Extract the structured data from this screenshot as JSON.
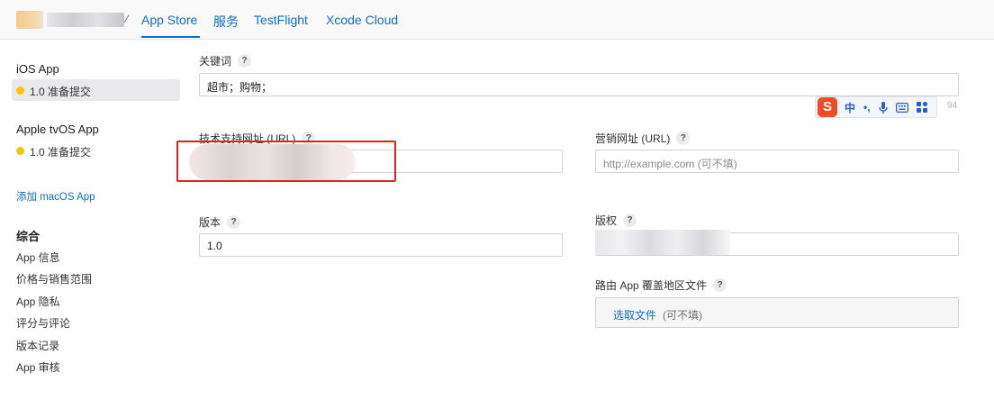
{
  "topbar": {
    "tabs": [
      {
        "label": "App Store",
        "active": true
      },
      {
        "label": "服务",
        "active": false
      },
      {
        "label": "TestFlight",
        "active": false
      },
      {
        "label": "Xcode Cloud",
        "active": false
      }
    ]
  },
  "sidebar": {
    "platforms": [
      {
        "title": "iOS App",
        "status": "1.0 准备提交",
        "selected": true
      },
      {
        "title": "Apple tvOS App",
        "status": "1.0 准备提交",
        "selected": false
      }
    ],
    "add_link": "添加 macOS App",
    "group_title": "综合",
    "items": [
      "App 信息",
      "价格与销售范围",
      "App 隐私",
      "评分与评论",
      "版本记录",
      "App 审核"
    ]
  },
  "form": {
    "keywords": {
      "label": "关键词",
      "value": "超市；购物；",
      "counter": "94"
    },
    "support_url": {
      "label": "技术支持网址 (URL)"
    },
    "marketing_url": {
      "label": "营销网址 (URL)",
      "placeholder": "http://example.com  (可不填)"
    },
    "version": {
      "label": "版本",
      "value": "1.0"
    },
    "copyright": {
      "label": "版权"
    },
    "routing": {
      "label": "路由 App 覆盖地区文件",
      "choose": "选取文件",
      "optional": "(可不填)"
    },
    "help_icon": "?"
  },
  "ime": {
    "logo": "S",
    "mode": "中",
    "punct": "•,",
    "icons": [
      "microphone-icon",
      "keyboard-icon",
      "grid-icon"
    ]
  },
  "colors": {
    "accent": "#0b6fce",
    "status_dot": "#f5c40c",
    "highlight": "#e0211e"
  }
}
